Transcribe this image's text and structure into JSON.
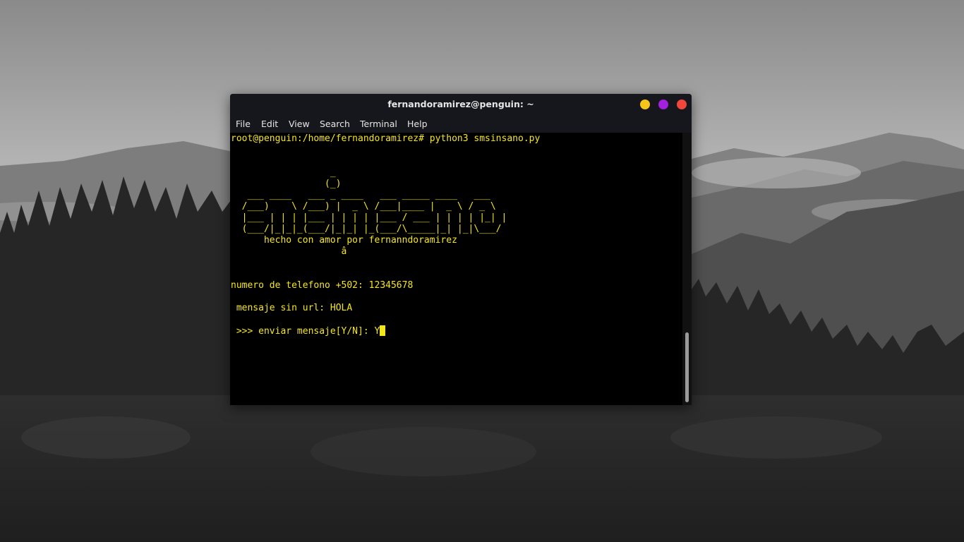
{
  "window": {
    "title": "fernandoramirez@penguin: ~"
  },
  "menu": {
    "file": "File",
    "edit": "Edit",
    "view": "View",
    "search": "Search",
    "terminal": "Terminal",
    "help": "Help"
  },
  "terminal": {
    "command": "root@penguin:/home/fernandoramirez# python3 smsinsano.py",
    "banner": [
      "                  _",
      "                 (_)",
      "   ___ ____   ___ _ ____   ___ _____ ____   ___",
      "  /___)    \\ /___) |  _ \\ /___|____ |  _ \\ / _ \\",
      "  |___ | | | |___ | | | | |___ / ___ | | | | |_| |",
      "  (___/|_|_|_(___/|_|_| |_(___/\\_____|_| |_|\\___/",
      "      hecho con amor por fernanndoramirez",
      "                    â"
    ],
    "phone_prompt": "numero de telefono +502: 12345678",
    "message_prompt": " mensaje sin url: HOLA",
    "send_prompt": " >>> enviar mensaje[Y/N]: Y"
  },
  "colors": {
    "terminal_text": "#f5e61c",
    "terminal_bg": "#000000",
    "titlebar_bg": "#16171c",
    "minimize": "#f5c518",
    "maximize": "#a51fe0",
    "close": "#f2463c"
  },
  "icons": {
    "minimize": "minimize-icon",
    "maximize": "maximize-icon",
    "close": "close-icon"
  }
}
